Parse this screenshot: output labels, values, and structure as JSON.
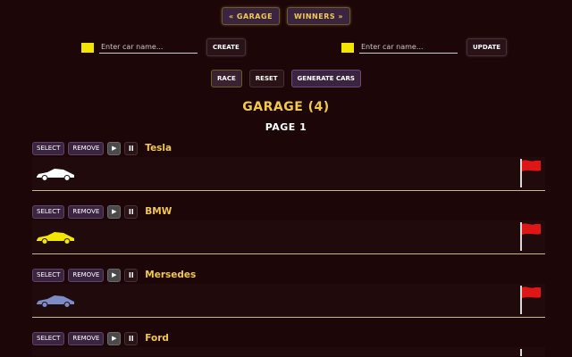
{
  "nav": {
    "garage_label": "« GARAGE",
    "winners_label": "WINNERS »"
  },
  "create_form": {
    "placeholder": "Enter car name...",
    "button_label": "CREATE",
    "color": "#f2e600"
  },
  "update_form": {
    "placeholder": "Enter car name...",
    "button_label": "UPDATE",
    "color": "#f2e600"
  },
  "controls": {
    "race_label": "RACE",
    "reset_label": "RESET",
    "generate_label": "GENERATE CARS"
  },
  "garage": {
    "title": "GARAGE (4)",
    "page": "PAGE 1"
  },
  "car_actions": {
    "select_label": "SELECT",
    "remove_label": "REMOVE",
    "start_icon": "play-icon",
    "stop_icon": "pause-icon"
  },
  "cars": [
    {
      "name": "Tesla",
      "color": "#ffffff"
    },
    {
      "name": "BMW",
      "color": "#f2e600"
    },
    {
      "name": "Mersedes",
      "color": "#7b8cc7"
    },
    {
      "name": "Ford",
      "color": "#ffffff"
    }
  ],
  "colors": {
    "accent": "#f2c94c",
    "background": "#1d0608",
    "finish_flag": "#e01616"
  }
}
